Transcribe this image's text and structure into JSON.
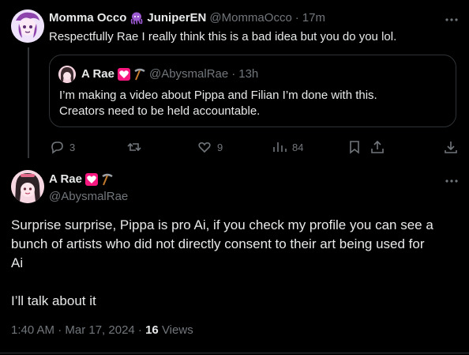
{
  "reply": {
    "display_name": "Momma Occo",
    "display_name_suffix": "JuniperEN",
    "handle": "@MommaOcco",
    "dot": "·",
    "time": "17m",
    "text": "Respectfully Rae I really think this is a bad idea but you do you lol.",
    "quote": {
      "display_name": "A Rae",
      "handle": "@AbysmalRae",
      "dot": "·",
      "time": "13h",
      "text_line1": "I’m making a video about Pippa and Filian I’m done with this.",
      "text_line2": "Creators need to be held accountable."
    },
    "actions": {
      "replies": "3",
      "reposts": "",
      "likes": "9",
      "views": "84"
    }
  },
  "main": {
    "display_name": "A Rae",
    "handle": "@AbysmalRae",
    "text_line1": "Surprise surprise, Pippa is pro Ai, if you check my profile you can see a",
    "text_line2": "bunch of artists who did not directly consent to their art being used for",
    "text_line3": "Ai",
    "text_line4": "I’ll talk about it",
    "meta_time": "1:40 AM · Mar 17, 2024 ·",
    "views_count": "16",
    "views_label": "Views"
  },
  "icons": {
    "more": "more-horizontal-icon",
    "reply": "reply-icon",
    "repost": "repost-icon",
    "like": "like-icon",
    "views": "views-icon",
    "bookmark": "bookmark-icon",
    "share": "share-icon",
    "download": "download-icon"
  },
  "colors": {
    "background": "#000000",
    "text": "#e7e9ea",
    "muted": "#71767b",
    "border": "#2f3336",
    "heart": "#f91880",
    "octopus": "#9b59d0"
  }
}
